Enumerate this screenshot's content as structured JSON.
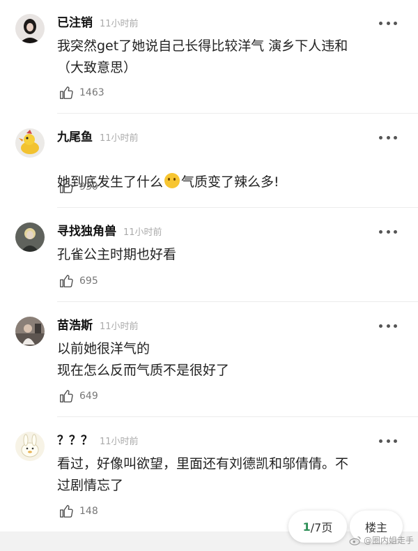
{
  "comments": [
    {
      "name": "已注销",
      "time": "11小时前",
      "text": "我突然get了她说自己长得比较洋气 演乡下人违和\n（大致意思）",
      "likes": "1463"
    },
    {
      "name": "九尾鱼",
      "time": "11小时前",
      "text_before": "她到底发生了什么",
      "text_after": "气质变了辣么多!",
      "likes": "930"
    },
    {
      "name": "寻找独角兽",
      "time": "11小时前",
      "text": "孔雀公主时期也好看",
      "likes": "695"
    },
    {
      "name": "苗浩斯",
      "time": "11小时前",
      "text": "以前她很洋气的\n现在怎么反而气质不是很好了",
      "likes": "649"
    },
    {
      "name": "？？？",
      "time": "11小时前",
      "text": "看过，好像叫欲望，里面还有刘德凯和邬倩倩。不\n过剧情忘了",
      "likes": "148"
    }
  ],
  "pager": {
    "current": "1",
    "total": "/7页"
  },
  "owner_label": "楼主",
  "watermark": "@圈内姐走手",
  "icons": {
    "like": "thumbs-up-icon",
    "more": "more-dots-icon",
    "emoji": "thinking-face-emoji"
  },
  "colors": {
    "accent": "#2e8f57",
    "time": "#aaaaaa",
    "likes": "#777777"
  }
}
